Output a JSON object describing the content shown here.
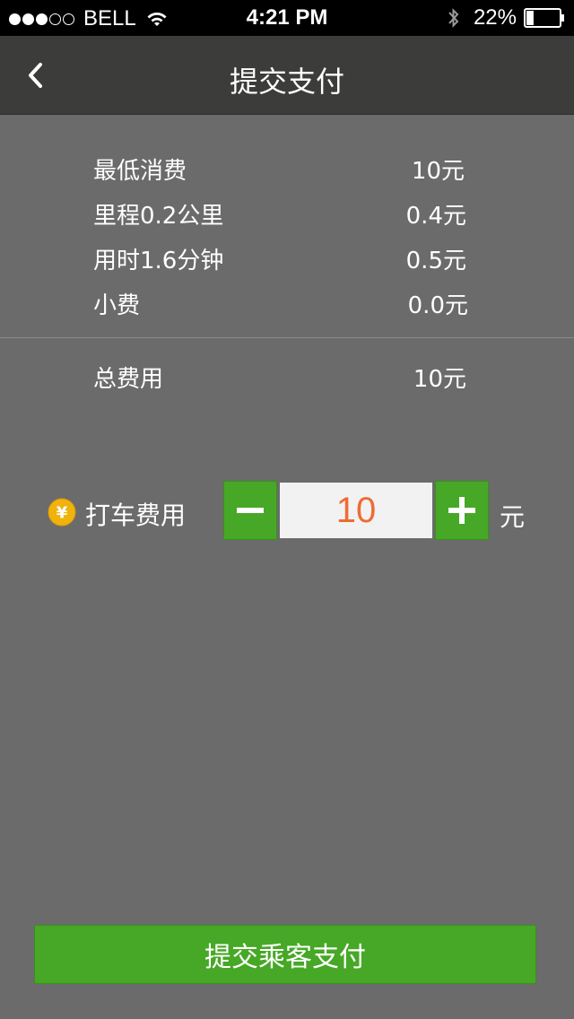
{
  "status_bar": {
    "carrier": "BELL",
    "time": "4:21 PM",
    "battery_percent": "22%",
    "battery_level": 0.22,
    "signal_bars_filled": 3,
    "signal_bars_total": 5
  },
  "nav": {
    "title": "提交支付",
    "back_icon": "chevron-left-icon"
  },
  "fees": [
    {
      "label": "最低消费",
      "value": "10元"
    },
    {
      "label": "里程0.2公里",
      "value": "0.4元"
    },
    {
      "label": "用时1.6分钟",
      "value": "0.5元"
    },
    {
      "label": "小费",
      "value": "0.0元"
    }
  ],
  "total": {
    "label": "总费用",
    "value": "10元"
  },
  "fare": {
    "label": "打车费用",
    "value": "10",
    "unit": "元",
    "coin_symbol": "¥"
  },
  "submit": {
    "label": "提交乘客支付"
  },
  "colors": {
    "accent_green": "#46a826",
    "fare_value": "#ef6b34",
    "background": "#6b6b6b",
    "nav_bar": "#3c3d3a",
    "coin": "#f0b20c"
  }
}
